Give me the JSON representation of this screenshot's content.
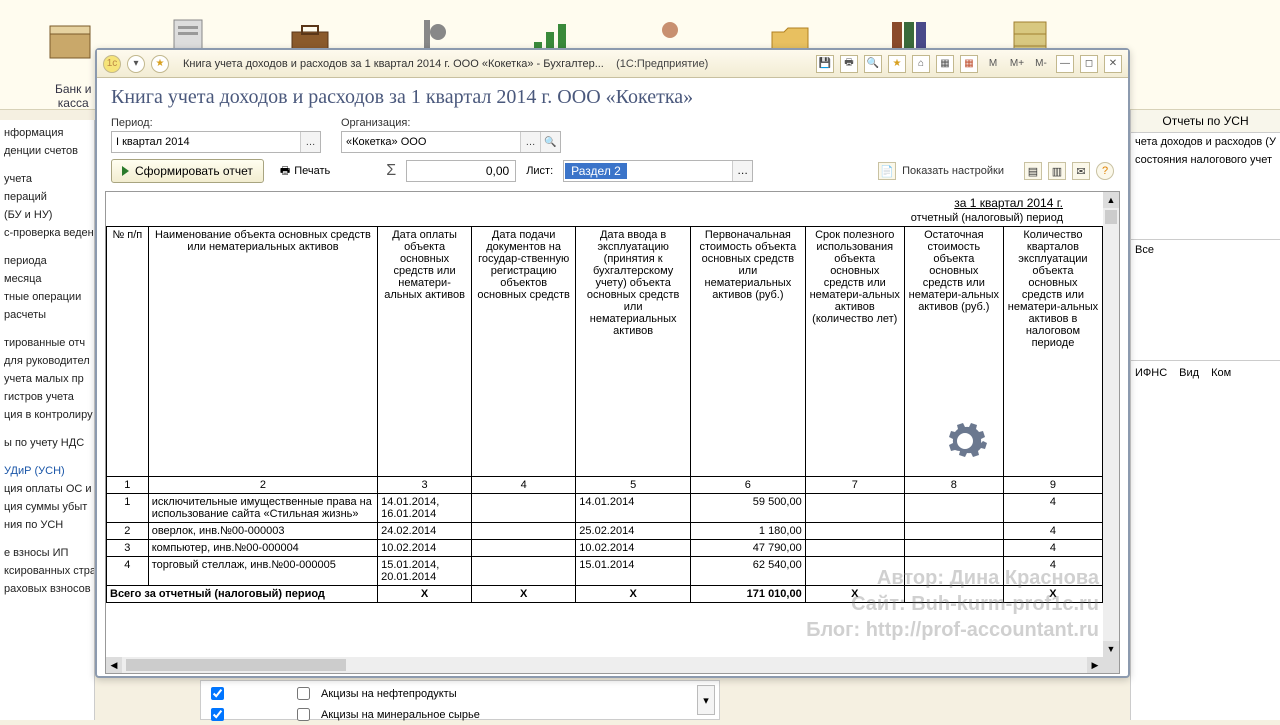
{
  "bg": {
    "label1": "Банк и",
    "label2": "касса"
  },
  "left_tree": [
    "нформация",
    "денции счетов",
    "",
    "учета",
    "пераций",
    "(БУ и НУ)",
    "с-проверка веден",
    "",
    "периода",
    "месяца",
    "тные операции",
    "расчеты",
    "",
    "тированные отч",
    "для руководител",
    "учета малых пр",
    "гистров учета",
    "ция в контролиру",
    "",
    "ы по учету НДС",
    "",
    "УДиР (УСН)",
    "ция оплаты ОС и",
    "ция суммы убыт",
    "ния по УСН",
    "",
    "е взносы ИП",
    "ксированных страховых ...",
    "раховых взносов с доходов"
  ],
  "right": {
    "title": "Отчеты по УСН",
    "rows": [
      "чета доходов и расходов (У",
      "состояния налогового учет"
    ],
    "all": "Все",
    "tabs": [
      "ИФНС",
      "Вид",
      "Ком"
    ]
  },
  "titlebar": {
    "title": "Книга учета доходов и расходов за 1 квартал 2014 г. ООО «Кокетка» - Бухгалтер...",
    "app": "(1С:Предприятие)",
    "m_items": [
      "M",
      "M+",
      "M-"
    ]
  },
  "header": "Книга учета доходов и расходов за 1 квартал 2014 г. ООО «Кокетка»",
  "filters": {
    "period_label": "Период:",
    "period_value": "I квартал 2014",
    "org_label": "Организация:",
    "org_value": "«Кокетка» ООО"
  },
  "actions": {
    "form": "Сформировать отчет",
    "print": "Печать",
    "sigma": "Σ",
    "amount": "0,00",
    "sheet_label": "Лист:",
    "sheet_value": "Раздел 2",
    "settings": "Показать настройки"
  },
  "report": {
    "period": "за 1 квартал 2014 г.",
    "subtitle": "отчетный (налоговый) период",
    "headers": [
      "№ п/п",
      "Наименование объекта основных средств или нематериальных активов",
      "Дата оплаты объекта основных средств или нематери-альных активов",
      "Дата подачи документов на государ-ственную регистрацию объектов основных средств",
      "Дата ввода в эксплуатацию (принятия к бухгалтерскому учету) объекта основных средств или нематериальных активов",
      "Первоначальная стоимость объекта основных средств или нематериальных активов (руб.)",
      "Срок полезного использования объекта основных средств или нематери-альных активов (количество лет)",
      "Остаточная стоимость объекта основных средств или нематери-альных активов (руб.)",
      "Количество кварталов эксплуатации объекта основных средств или нематери-альных активов в налоговом периоде"
    ],
    "numrow": [
      "1",
      "2",
      "3",
      "4",
      "5",
      "6",
      "7",
      "8",
      "9"
    ],
    "rows": [
      {
        "n": "1",
        "name": "исключительные имущественные права на использование сайта «Стильная жизнь»",
        "c3": "14.01.2014, 16.01.2014",
        "c4": "",
        "c5": "14.01.2014",
        "c6": "59 500,00",
        "c7": "",
        "c8": "",
        "c9": "4"
      },
      {
        "n": "2",
        "name": "оверлок, инв.№00-000003",
        "c3": "24.02.2014",
        "c4": "",
        "c5": "25.02.2014",
        "c6": "1 180,00",
        "c7": "",
        "c8": "",
        "c9": "4"
      },
      {
        "n": "3",
        "name": "компьютер, инв.№00-000004",
        "c3": "10.02.2014",
        "c4": "",
        "c5": "10.02.2014",
        "c6": "47 790,00",
        "c7": "",
        "c8": "",
        "c9": "4"
      },
      {
        "n": "4",
        "name": "торговый стеллаж, инв.№00-000005",
        "c3": "15.01.2014, 20.01.2014",
        "c4": "",
        "c5": "15.01.2014",
        "c6": "62 540,00",
        "c7": "",
        "c8": "",
        "c9": "4"
      }
    ],
    "totals": {
      "label": "Всего за отчетный  (налоговый) период",
      "c3": "X",
      "c4": "X",
      "c5": "X",
      "c6": "171 010,00",
      "c7": "X",
      "c8": "",
      "c9": "X"
    }
  },
  "watermark": [
    "Автор: Дина Краснова",
    "Сайт: Buh-kurm-prof1c.ru",
    "Блог: http://prof-accountant.ru"
  ],
  "bottom": {
    "row1": "Акцизы на нефтепродукты",
    "row2": "Акцизы на минеральное сырье"
  }
}
